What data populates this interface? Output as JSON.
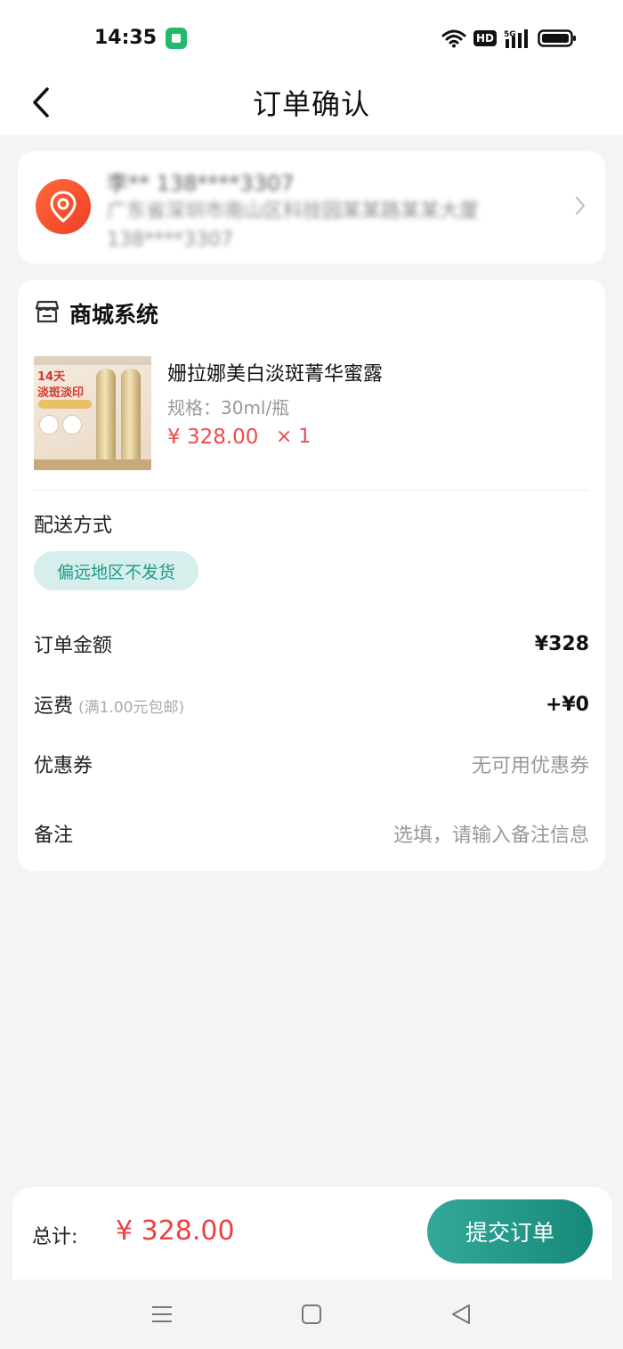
{
  "status_bar": {
    "time": "14:35",
    "hd": "HD",
    "network": "5G"
  },
  "header": {
    "title": "订单确认"
  },
  "address": {
    "name_line": "李** 138****3307",
    "detail_line": "广东省深圳市南山区科技园某某路某某大厦",
    "phone_line": "138****3307"
  },
  "order": {
    "store_name": "商城系统",
    "product": {
      "name": "姗拉娜美白淡斑菁华蜜露",
      "spec": "规格：30ml/瓶",
      "price": "¥ 328.00",
      "quantity": "× 1",
      "image_text_1": "14天",
      "image_text_2": "淡斑淡印"
    },
    "delivery_label": "配送方式",
    "delivery_chip": "偏远地区不发货",
    "amount_label": "订单金额",
    "amount_value": "¥328",
    "shipping_label": "运费",
    "shipping_note": "(满1.00元包邮)",
    "shipping_value": "+¥0",
    "coupon_label": "优惠券",
    "coupon_value": "无可用优惠券",
    "remark_label": "备注",
    "remark_placeholder": "选填，请输入备注信息"
  },
  "footer": {
    "total_label": "总计:",
    "total_amount": "¥ 328.00",
    "submit_label": "提交订单"
  },
  "colors": {
    "accent": "#1f9a8a",
    "price": "#f04a4a",
    "location": "#ee3e24"
  }
}
